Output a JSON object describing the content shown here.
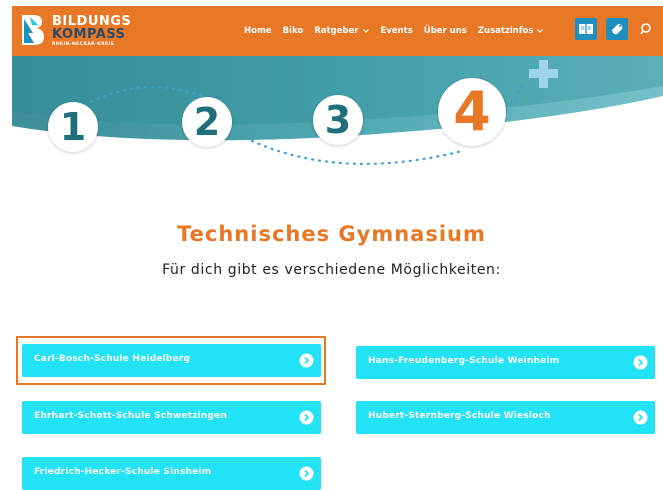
{
  "header": {
    "logo": {
      "line1": "BILDUNGS",
      "line2": "KOMPASS",
      "line3": "RHEIN-NECKAR-KREIS"
    },
    "nav": [
      {
        "label": "Home",
        "dropdown": false
      },
      {
        "label": "Biko",
        "dropdown": false
      },
      {
        "label": "Ratgeber",
        "dropdown": true
      },
      {
        "label": "Events",
        "dropdown": false
      },
      {
        "label": "Über uns",
        "dropdown": false
      },
      {
        "label": "Zusatzinfos",
        "dropdown": true
      }
    ],
    "icons": [
      "book-icon",
      "hand-icon",
      "search-icon"
    ]
  },
  "hero": {
    "steps": [
      "1",
      "2",
      "3",
      "4"
    ]
  },
  "main": {
    "title": "Technisches Gymnasium",
    "subtitle": "Für dich gibt es verschiedene Möglichkeiten:",
    "schools": [
      "Carl-Bosch-Schule Heidelberg",
      "Hans-Freudenberg-Schule Weinheim",
      "Ehrhart-Schott-Schule Schwetzingen",
      "Hubert-Sternberg-Schule Wiesloch",
      "Friedrich-Hecker-Schule Sinsheim"
    ],
    "highlighted_school": "Carl-Bosch-Schule Heidelberg"
  },
  "colors": {
    "orange": "#e87726",
    "cyan": "#22e3f5",
    "teal": "#1f6f7a",
    "blue": "#1e8fbf"
  }
}
